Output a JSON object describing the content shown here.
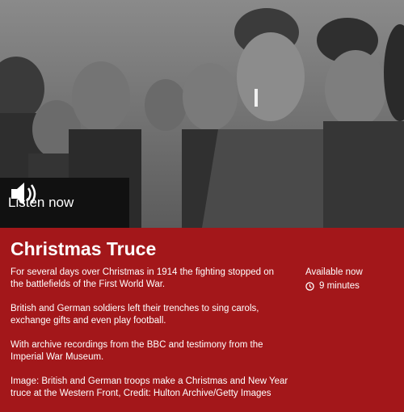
{
  "hero": {
    "listen_label": "Listen now",
    "listen_icon": "speaker-icon"
  },
  "programme": {
    "title": "Christmas Truce",
    "paragraphs": [
      "For several days over Christmas in 1914 the fighting stopped on the battlefields of the First World War.",
      "British and German soldiers left their trenches to sing carols, exchange gifts and even play football.",
      "With archive recordings from the BBC and testimony from the Imperial War Museum.",
      "Image: British and German troops make a Christmas and New Year truce at the Western Front, Credit: Hulton Archive/Getty Images"
    ],
    "availability": "Available now",
    "duration": "9 minutes",
    "duration_icon": "clock-icon"
  },
  "colors": {
    "panel_bg": "#a3171a",
    "listen_bg": "#111111",
    "text": "#ffffff"
  }
}
